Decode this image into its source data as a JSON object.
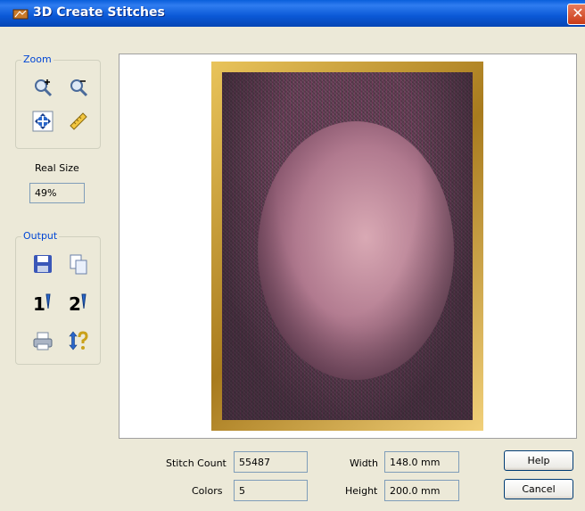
{
  "window": {
    "title": "3D Create Stitches",
    "close_label": "✕"
  },
  "zoom_group": {
    "label": "Zoom"
  },
  "real_size": {
    "label": "Real Size",
    "value": "49%"
  },
  "output_group": {
    "label": "Output",
    "print1_label": "1",
    "print2_label": "2"
  },
  "stats": {
    "stitch_count_label": "Stitch Count",
    "stitch_count": "55487",
    "colors_label": "Colors",
    "colors": "5",
    "width_label": "Width",
    "width": "148.0 mm",
    "height_label": "Height",
    "height": "200.0 mm"
  },
  "buttons": {
    "help": "Help",
    "cancel": "Cancel"
  },
  "colors": {
    "titlebar": "#0a58d6",
    "group_label": "#0046d5",
    "frame_gold": "#c99a34"
  }
}
